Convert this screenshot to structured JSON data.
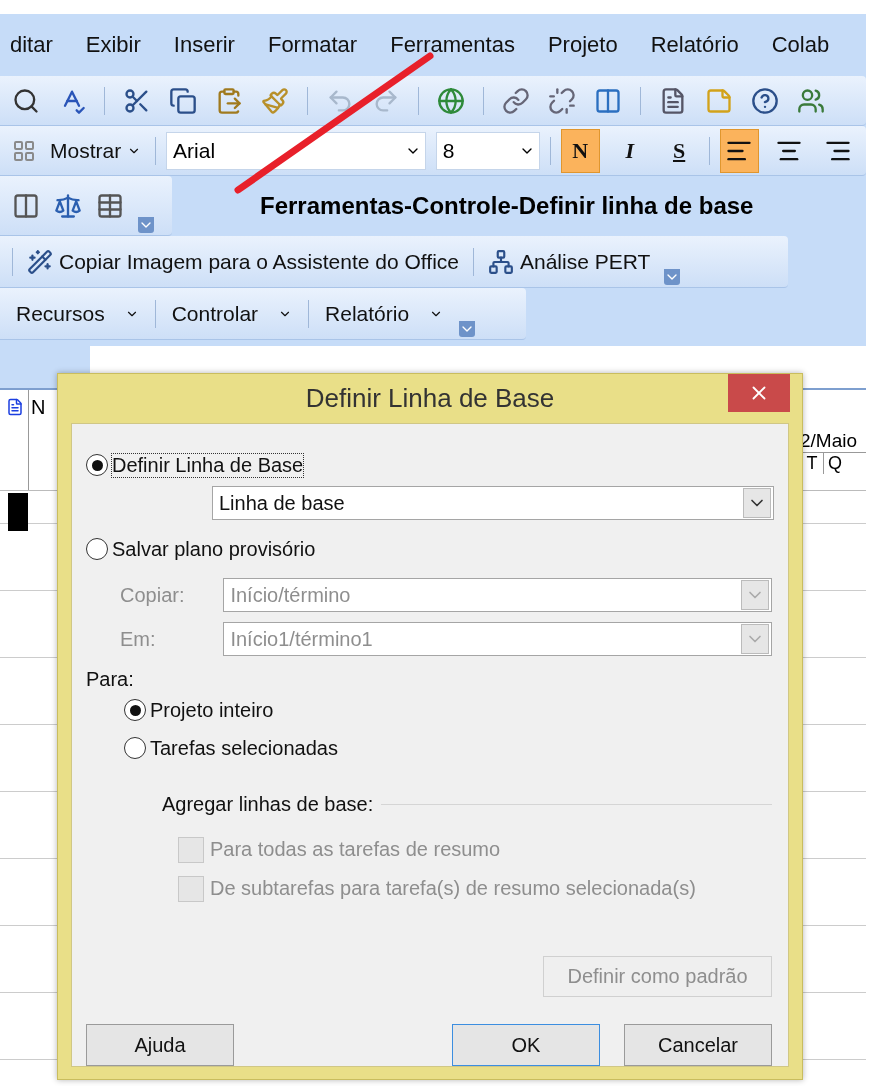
{
  "menu": [
    "ditar",
    "Exibir",
    "Inserir",
    "Formatar",
    "Ferramentas",
    "Projeto",
    "Relatório",
    "Colab"
  ],
  "format_bar": {
    "show_label": "Mostrar",
    "font": "Arial",
    "size": "8",
    "styles": [
      {
        "label": "N",
        "kind": "bold",
        "selected": true
      },
      {
        "label": "I",
        "kind": "italic",
        "selected": false
      },
      {
        "label": "S",
        "kind": "underline",
        "selected": false
      }
    ],
    "align": [
      {
        "kind": "left",
        "selected": true
      },
      {
        "kind": "center",
        "selected": false
      },
      {
        "kind": "right",
        "selected": false
      }
    ]
  },
  "annotation": "Ferramentas-Controle-Definir linha de base",
  "assistant_bar": [
    "Copiar Imagem para o Assistente do Office",
    "Análise PERT"
  ],
  "tracking_bar": [
    "Recursos",
    "Controlar",
    "Relatório"
  ],
  "grid": {
    "column_header": "N",
    "timescale": "2/Maio",
    "days": [
      "T",
      "Q"
    ]
  },
  "dialog": {
    "title": "Definir Linha de Base",
    "modes": [
      {
        "label": "Definir Linha de Base",
        "selected": true
      },
      {
        "label": "Salvar plano provisório",
        "selected": false
      }
    ],
    "baseline_select": "Linha de base",
    "copy_fields": [
      {
        "label": "Copiar:",
        "value": "Início/término",
        "disabled": true
      },
      {
        "label": "Em:",
        "value": "Início1/término1",
        "disabled": true
      }
    ],
    "for_label": "Para:",
    "scope": [
      {
        "label": "Projeto inteiro",
        "selected": true
      },
      {
        "label": "Tarefas selecionadas",
        "selected": false
      }
    ],
    "rollup_label": "Agregar linhas de base:",
    "rollup": [
      {
        "label": "Para todas as tarefas de resumo",
        "checked": false,
        "disabled": true
      },
      {
        "label": "De subtarefas para tarefa(s) de resumo selecionada(s)",
        "checked": false,
        "disabled": true
      }
    ],
    "default_button": {
      "label": "Definir como padrão",
      "disabled": true
    },
    "buttons": [
      {
        "label": "Ajuda",
        "default": false
      },
      {
        "label": "OK",
        "default": true
      },
      {
        "label": "Cancelar",
        "default": false
      }
    ]
  }
}
